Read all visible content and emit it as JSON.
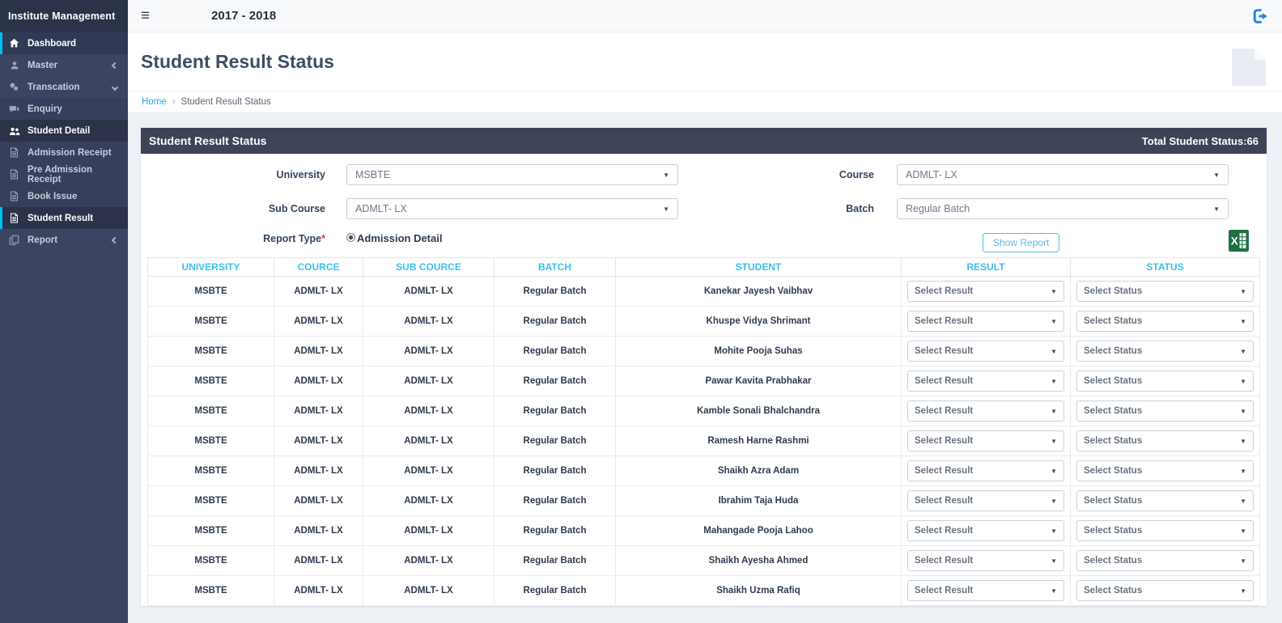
{
  "colors": {
    "accent_cyan": "#00c0ef",
    "table_header_cyan": "#3bc0ea",
    "link_blue": "#2aa6e4",
    "logout_blue": "#1e88e5",
    "excel_green": "#1d7044",
    "panel_header": "#3d4458",
    "sidebar_bg": "#3b4562"
  },
  "sidebar": {
    "brand": "Institute Management",
    "items": [
      {
        "label": "Dashboard",
        "icon": "home-icon"
      },
      {
        "label": "Master",
        "icon": "user-icon"
      },
      {
        "label": "Transcation",
        "icon": "transaction-icon"
      },
      {
        "label": "Enquiry",
        "icon": "comment-icon"
      },
      {
        "label": "Student Detail",
        "icon": "users-icon"
      },
      {
        "label": "Admission Receipt",
        "icon": "file-icon"
      },
      {
        "label": "Pre Admission Receipt",
        "icon": "file-icon"
      },
      {
        "label": "Book Issue",
        "icon": "file-icon"
      },
      {
        "label": "Student Result",
        "icon": "file-icon"
      },
      {
        "label": "Report",
        "icon": "copy-icon"
      }
    ]
  },
  "topbar": {
    "menu_icon": "≡",
    "session": "2017 - 2018",
    "logout_icon": "logout-icon"
  },
  "page": {
    "title": "Student Result Status",
    "breadcrumb": {
      "home": "Home",
      "separator": "›",
      "current": "Student Result Status"
    }
  },
  "panel": {
    "title": "Student Result Status",
    "total": "Total Student Status:66"
  },
  "form": {
    "university": {
      "label": "University",
      "value": "MSBTE"
    },
    "course": {
      "label": "Course",
      "value": "ADMLT- LX"
    },
    "sub_course": {
      "label": "Sub Course",
      "value": "ADMLT- LX"
    },
    "batch": {
      "label": "Batch",
      "value": "Regular Batch"
    },
    "report_type": {
      "label": "Report Type",
      "required": "*",
      "option": "Admission Detail"
    },
    "show_report_label": "Show Report",
    "excel_icon": "excel-export-icon"
  },
  "table": {
    "headers": [
      "UNIVERSITY",
      "COURCE",
      "SUB COURCE",
      "BATCH",
      "STUDENT",
      "RESULT",
      "STATUS"
    ],
    "result_placeholder": "Select Result",
    "status_placeholder": "Select Status",
    "rows": [
      {
        "university": "MSBTE",
        "cource": "ADMLT- LX",
        "sub_cource": "ADMLT- LX",
        "batch": "Regular Batch",
        "student": "Kanekar Jayesh Vaibhav"
      },
      {
        "university": "MSBTE",
        "cource": "ADMLT- LX",
        "sub_cource": "ADMLT- LX",
        "batch": "Regular Batch",
        "student": "Khuspe Vidya Shrimant"
      },
      {
        "university": "MSBTE",
        "cource": "ADMLT- LX",
        "sub_cource": "ADMLT- LX",
        "batch": "Regular Batch",
        "student": "Mohite Pooja Suhas"
      },
      {
        "university": "MSBTE",
        "cource": "ADMLT- LX",
        "sub_cource": "ADMLT- LX",
        "batch": "Regular Batch",
        "student": "Pawar Kavita Prabhakar"
      },
      {
        "university": "MSBTE",
        "cource": "ADMLT- LX",
        "sub_cource": "ADMLT- LX",
        "batch": "Regular Batch",
        "student": "Kamble Sonali Bhalchandra"
      },
      {
        "university": "MSBTE",
        "cource": "ADMLT- LX",
        "sub_cource": "ADMLT- LX",
        "batch": "Regular Batch",
        "student": "Ramesh Harne Rashmi"
      },
      {
        "university": "MSBTE",
        "cource": "ADMLT- LX",
        "sub_cource": "ADMLT- LX",
        "batch": "Regular Batch",
        "student": "Shaikh Azra Adam"
      },
      {
        "university": "MSBTE",
        "cource": "ADMLT- LX",
        "sub_cource": "ADMLT- LX",
        "batch": "Regular Batch",
        "student": "Ibrahim Taja Huda"
      },
      {
        "university": "MSBTE",
        "cource": "ADMLT- LX",
        "sub_cource": "ADMLT- LX",
        "batch": "Regular Batch",
        "student": "Mahangade Pooja Lahoo"
      },
      {
        "university": "MSBTE",
        "cource": "ADMLT- LX",
        "sub_cource": "ADMLT- LX",
        "batch": "Regular Batch",
        "student": "Shaikh Ayesha Ahmed"
      },
      {
        "university": "MSBTE",
        "cource": "ADMLT- LX",
        "sub_cource": "ADMLT- LX",
        "batch": "Regular Batch",
        "student": "Shaikh Uzma Rafiq"
      }
    ]
  }
}
